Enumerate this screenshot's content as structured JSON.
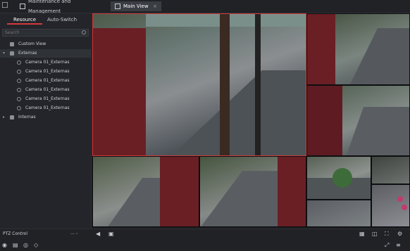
{
  "app": {
    "tabs": [
      {
        "label": "Maintenance and Management"
      },
      {
        "label": "Main View"
      }
    ]
  },
  "sidebar": {
    "subtabs": [
      "Resource",
      "Auto-Switch"
    ],
    "search_placeholder": "Search",
    "tree": {
      "custom_view": "Custom View",
      "externas": "Externas",
      "cameras": [
        "Camera 01_Externas",
        "Camera 01_Externas",
        "Camera 01_Externas",
        "Camera 01_Externas",
        "Camera 01_Externas",
        "Camera 01_Externas"
      ],
      "internas": "Internas"
    }
  },
  "bottombar": {
    "ptz_label": "PTZ Control"
  },
  "grid": {
    "selected_cell": 0,
    "layout": "1+5+4 mixed",
    "cells": [
      {
        "name": "",
        "timestamp": ""
      },
      {
        "name": "",
        "timestamp": ""
      },
      {
        "name": "",
        "timestamp": ""
      },
      {
        "name": "",
        "timestamp": ""
      },
      {
        "name": "",
        "timestamp": ""
      },
      {
        "name": "",
        "timestamp": ""
      },
      {
        "name": "",
        "timestamp": ""
      },
      {
        "name": "",
        "timestamp": ""
      }
    ]
  },
  "colors": {
    "accent": "#d23a3a",
    "background": "#1b1c1f",
    "sidebar": "#23252a"
  }
}
